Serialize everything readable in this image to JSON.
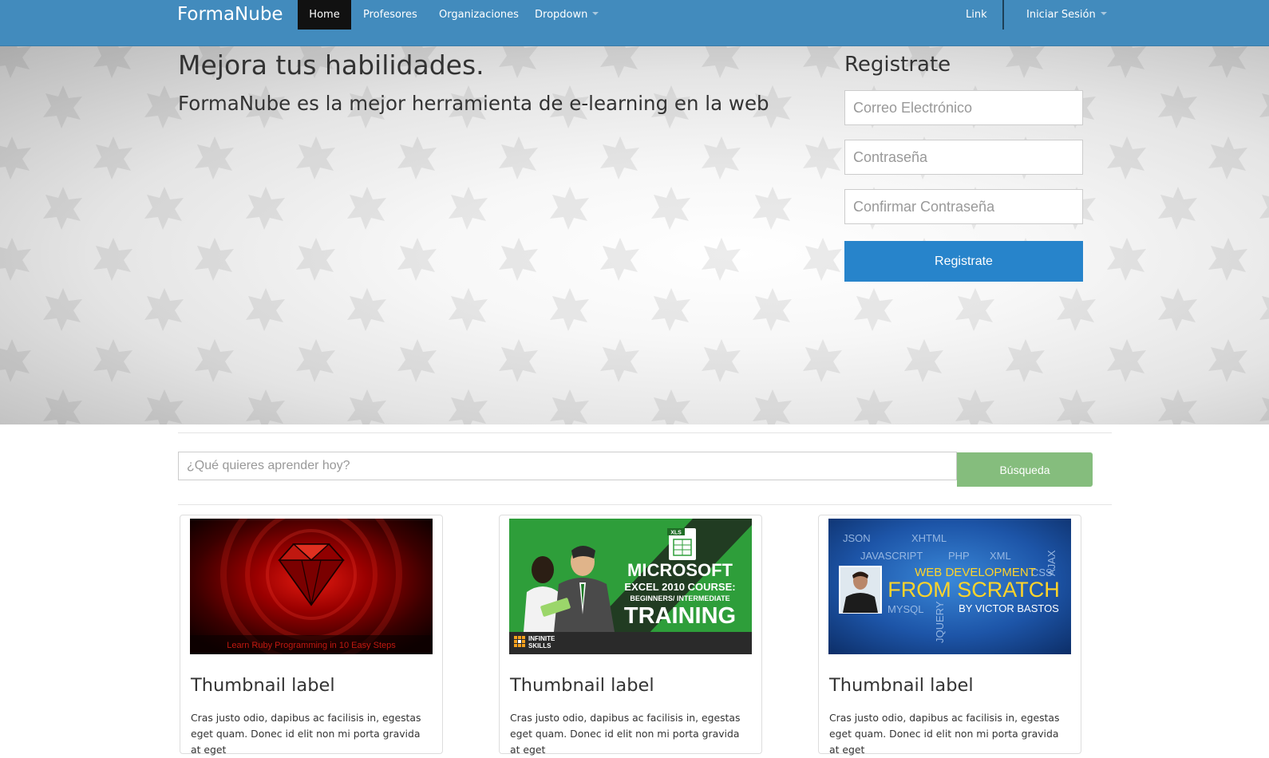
{
  "navbar": {
    "brand": "FormaNube",
    "items": [
      {
        "label": "Home",
        "active": true
      },
      {
        "label": "Profesores"
      },
      {
        "label": "Organizaciones"
      },
      {
        "label": "Dropdown",
        "dropdown": true
      }
    ],
    "right_items": [
      {
        "label": "Link"
      },
      {
        "label": "Iniciar Sesión",
        "dropdown": true
      }
    ],
    "color": "#428bbd"
  },
  "hero": {
    "title": "Mejora tus habilidades.",
    "subtitle": "FormaNube es la mejor herramienta de e-learning en la web"
  },
  "register": {
    "title": "Registrate",
    "email_placeholder": "Correo Electrónico",
    "password_placeholder": "Contraseña",
    "confirm_placeholder": "Confirmar Contraseña",
    "button_label": "Registrate",
    "button_color": "#2784cb"
  },
  "search": {
    "placeholder": "¿Qué quieres aprender hoy?",
    "button_label": "Búsqueda",
    "button_color": "#85bd7d"
  },
  "thumbnails": [
    {
      "label": "Thumbnail label",
      "text": "Cras justo odio, dapibus ac facilisis in, egestas eget quam. Donec id elit non mi porta gravida at eget",
      "image": {
        "caption": "Learn Ruby Programming in 10 Easy Steps"
      }
    },
    {
      "label": "Thumbnail label",
      "text": "Cras justo odio, dapibus ac facilisis in, egestas eget quam. Donec id elit non mi porta gravida at eget",
      "image": {
        "badge": "XLS",
        "line1": "MICROSOFT",
        "line2": "EXCEL 2010 COURSE:",
        "line3": "BEGINNERS/ INTERMEDIATE",
        "line4": "TRAINING",
        "logo_line1": "INFINITE",
        "logo_line2": "SKILLS"
      }
    },
    {
      "label": "Thumbnail label",
      "text": "Cras justo odio, dapibus ac facilisis in, egestas eget quam. Donec id elit non mi porta gravida at eget",
      "image": {
        "tags": [
          "JSON",
          "XHTML",
          "JAVASCRIPT",
          "PHP",
          "XML",
          "CSS",
          "AJAX",
          "MYSQL",
          "JQUERY"
        ],
        "line1": "WEB DEVELOPMENT",
        "line2": "FROM SCRATCH",
        "line3": "BY VICTOR BASTOS"
      }
    }
  ]
}
